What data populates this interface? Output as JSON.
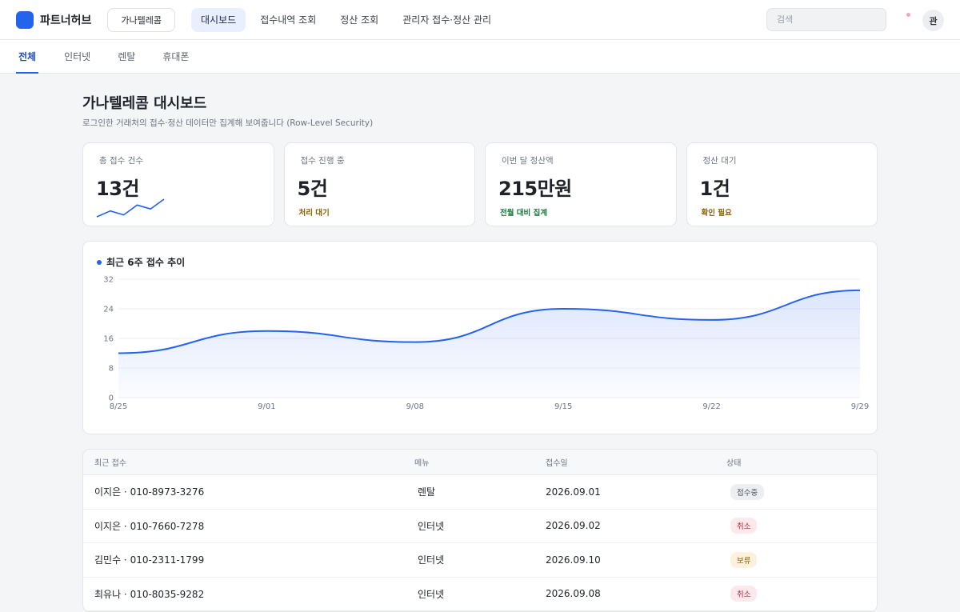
{
  "app": {
    "name": "파트너허브",
    "brand_color": "#2463eb"
  },
  "partner": {
    "label": "가나텔레콤"
  },
  "nav": {
    "items": [
      {
        "label": "대시보드",
        "active": true
      },
      {
        "label": "접수내역 조회",
        "active": false
      },
      {
        "label": "정산 조회",
        "active": false
      },
      {
        "label": "관리자 접수·정산 관리",
        "active": false
      }
    ]
  },
  "search": {
    "placeholder": "검색"
  },
  "user": {
    "avatar_text": "관"
  },
  "subtabs": [
    {
      "label": "전체",
      "active": true
    },
    {
      "label": "인터넷",
      "active": false
    },
    {
      "label": "렌탈",
      "active": false
    },
    {
      "label": "휴대폰",
      "active": false
    }
  ],
  "page": {
    "title": "가나텔레콤 대시보드",
    "subtitle": "로그인한 거래처의 접수·정산 데이터만 집계해 보여줍니다 (Row-Level Security)"
  },
  "kpis": [
    {
      "label": "총 접수 건수",
      "value": "13건",
      "note": "",
      "sparkline": [
        2,
        5,
        3,
        8,
        6,
        11
      ]
    },
    {
      "label": "접수 진행 중",
      "value": "5건",
      "note": "처리 대기",
      "note_color": "#8a6200"
    },
    {
      "label": "이번 달 정산액",
      "value": "215만원",
      "note": "전월 대비 집계",
      "note_color": "#1b7a3c"
    },
    {
      "label": "정산 대기",
      "value": "1건",
      "note": "확인 필요",
      "note_color": "#8a6200"
    }
  ],
  "chart": {
    "title": "최근 6주 접수 추이"
  },
  "chart_data": {
    "type": "area",
    "title": "최근 6주 접수 추이",
    "x": [
      "8/25",
      "9/01",
      "9/08",
      "9/15",
      "9/22",
      "9/29"
    ],
    "series": [
      {
        "values": [
          12,
          18,
          15,
          24,
          21,
          29
        ]
      }
    ],
    "y_ticks": [
      0,
      8,
      16,
      24,
      32
    ],
    "ylim": [
      0,
      32
    ],
    "grid": true,
    "line_color": "#2463eb"
  },
  "table": {
    "headers": [
      "최근 접수",
      "메뉴",
      "접수일",
      "상태"
    ],
    "rows": [
      {
        "customer": "이지은 · 010-8973-3276",
        "menu": "렌탈",
        "date": "2026.09.01",
        "status": "접수중",
        "status_type": "progress"
      },
      {
        "customer": "이지은 · 010-7660-7278",
        "menu": "인터넷",
        "date": "2026.09.02",
        "status": "취소",
        "status_type": "cancel"
      },
      {
        "customer": "김민수 · 010-2311-1799",
        "menu": "인터넷",
        "date": "2026.09.10",
        "status": "보류",
        "status_type": "hold"
      },
      {
        "customer": "최유나 · 010-8035-9282",
        "menu": "인터넷",
        "date": "2026.09.08",
        "status": "취소",
        "status_type": "cancel"
      }
    ]
  }
}
